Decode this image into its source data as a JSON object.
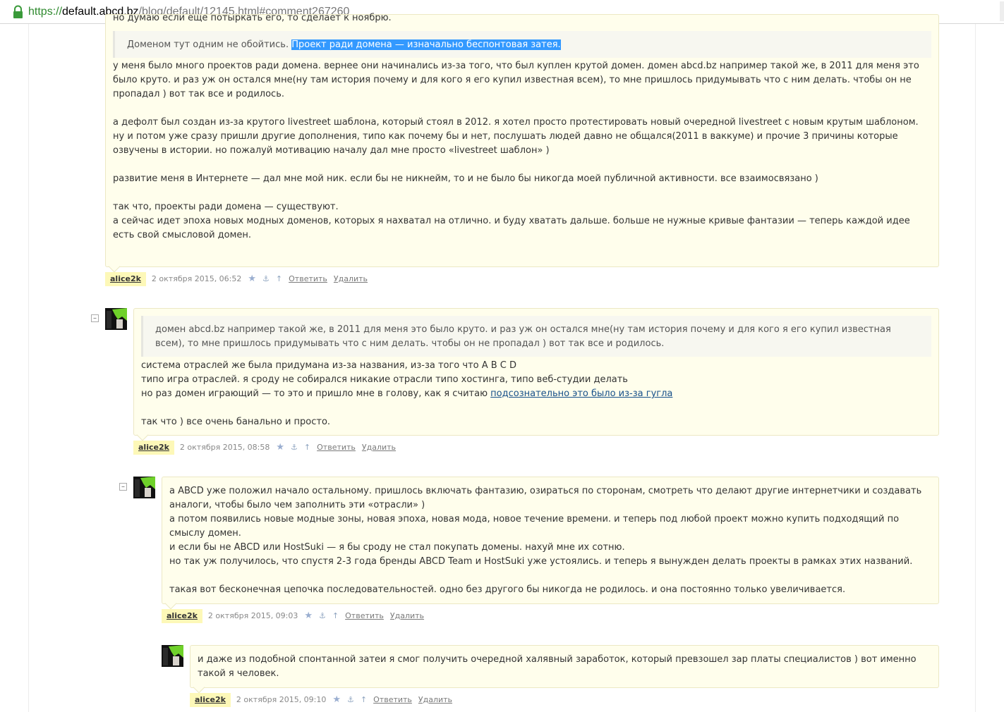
{
  "browser": {
    "url_scheme": "https://",
    "url_host": "default.abcd.bz",
    "url_path": "/blog/default/12145.html#comment267260"
  },
  "comments": [
    {
      "top_fragment": "но думаю если еще потыркать его, то сделает к ноябрю.",
      "quote_plain": "Доменом тут одним не обойтись. ",
      "quote_selected": "Проект ради домена — изначально беспонтовая затея.",
      "paragraphs": [
        "у меня было много проектов ради домена. вернее они начинались из-за того, что был куплен крутой домен. домен abcd.bz например такой же, в 2011 для меня это было круто. и раз уж он остался мне(ну там история почему и для кого я его купил известная всем), то мне пришлось придумывать что с ним делать. чтобы он не пропадал ) вот так все и родилось.",
        "а дефолт был создан из-за крутого livestreet шаблона, который стоял в 2012. я хотел просто протестировать новый очередной livestreet с новым крутым шаблоном. ну и потом уже сразу пришли другие дополнения, типо как почему бы и нет, послушать людей давно не общался(2011 в ваккуме) и прочие 3 причины которые озвучены в истории. но пожалуй мотивацию началу дал мне просто «livestreet шаблон» )",
        "развитие меня в Интернете — дал мне мой ник. если бы не никнейм, то и не было бы никогда моей публичной активности. все взаимосвязано )",
        "так что, проекты ради домена — существуют.\nа сейчас идет эпоха новых модных доменов, которых я нахватал на отлично. и буду хватать дальше. больше не нужные кривые фантазии — теперь каждой идее есть свой смысловой домен."
      ],
      "author": "alice2k",
      "date": "2 октября 2015, 06:52"
    },
    {
      "quote": "домен abcd.bz например такой же, в 2011 для меня это было круто. и раз уж он остался мне(ну там история почему и для кого я его купил известная всем), то мне пришлось придумывать что с ним делать. чтобы он не пропадал ) вот так все и родилось.",
      "lines": [
        "система отраслей же была придумана из-за названия, из-за того что A B C D",
        "типо игра отраслей. я сроду не собирался никакие отрасли типо хостинга, типо веб-студии делать",
        "но раз домен играющий — то это и пришло мне в голову, как я считаю "
      ],
      "link_text": "подсознательно это было из-за гугла",
      "closing": "так что ) все очень банально и просто.",
      "author": "alice2k",
      "date": "2 октября 2015, 08:58"
    },
    {
      "paragraphs": [
        "а ABCD уже положил начало остальному. пришлось включать фантазию, озираться по сторонам, смотреть что делают другие интернетчики и создавать аналоги, чтобы было чем заполнить эти «отрасли» )\nа потом появились новые модные зоны, новая эпоха, новая мода, новое течение времени. и теперь под любой проект можно купить подходящий по смыслу домен.\nи если бы не ABCD или HostSuki — я бы сроду не стал покупать домены. нахуй мне их сотню.\nно так уж получилось, что спустя 2-3 года бренды ABCD Team и HostSuki уже устоялись. и теперь я вынужден делать проекты в рамках этих названий.",
        "такая вот бесконечная цепочка последовательностей. одно без другого бы никогда не родилось. и она постоянно только увеличивается."
      ],
      "author": "alice2k",
      "date": "2 октября 2015, 09:03"
    },
    {
      "paragraphs": [
        "и даже из подобной спонтанной затеи я смог получить очередной халявный заработок, который превзошел зар платы специалистов ) вот именно такой я человек."
      ],
      "author": "alice2k",
      "date": "2 октября 2015, 09:10"
    }
  ],
  "actions": {
    "reply": "Ответить",
    "delete": "Удалить",
    "fold_symbol": "–",
    "star_icon": "★",
    "anchor_icon": "⚓",
    "up_icon": "↑"
  },
  "colors": {
    "comment_bg": "#fffeec",
    "author_highlight": "#fdf8b8",
    "selection": "#3399ff",
    "link": "#17508a",
    "secure_scheme": "#2f8a2f"
  }
}
